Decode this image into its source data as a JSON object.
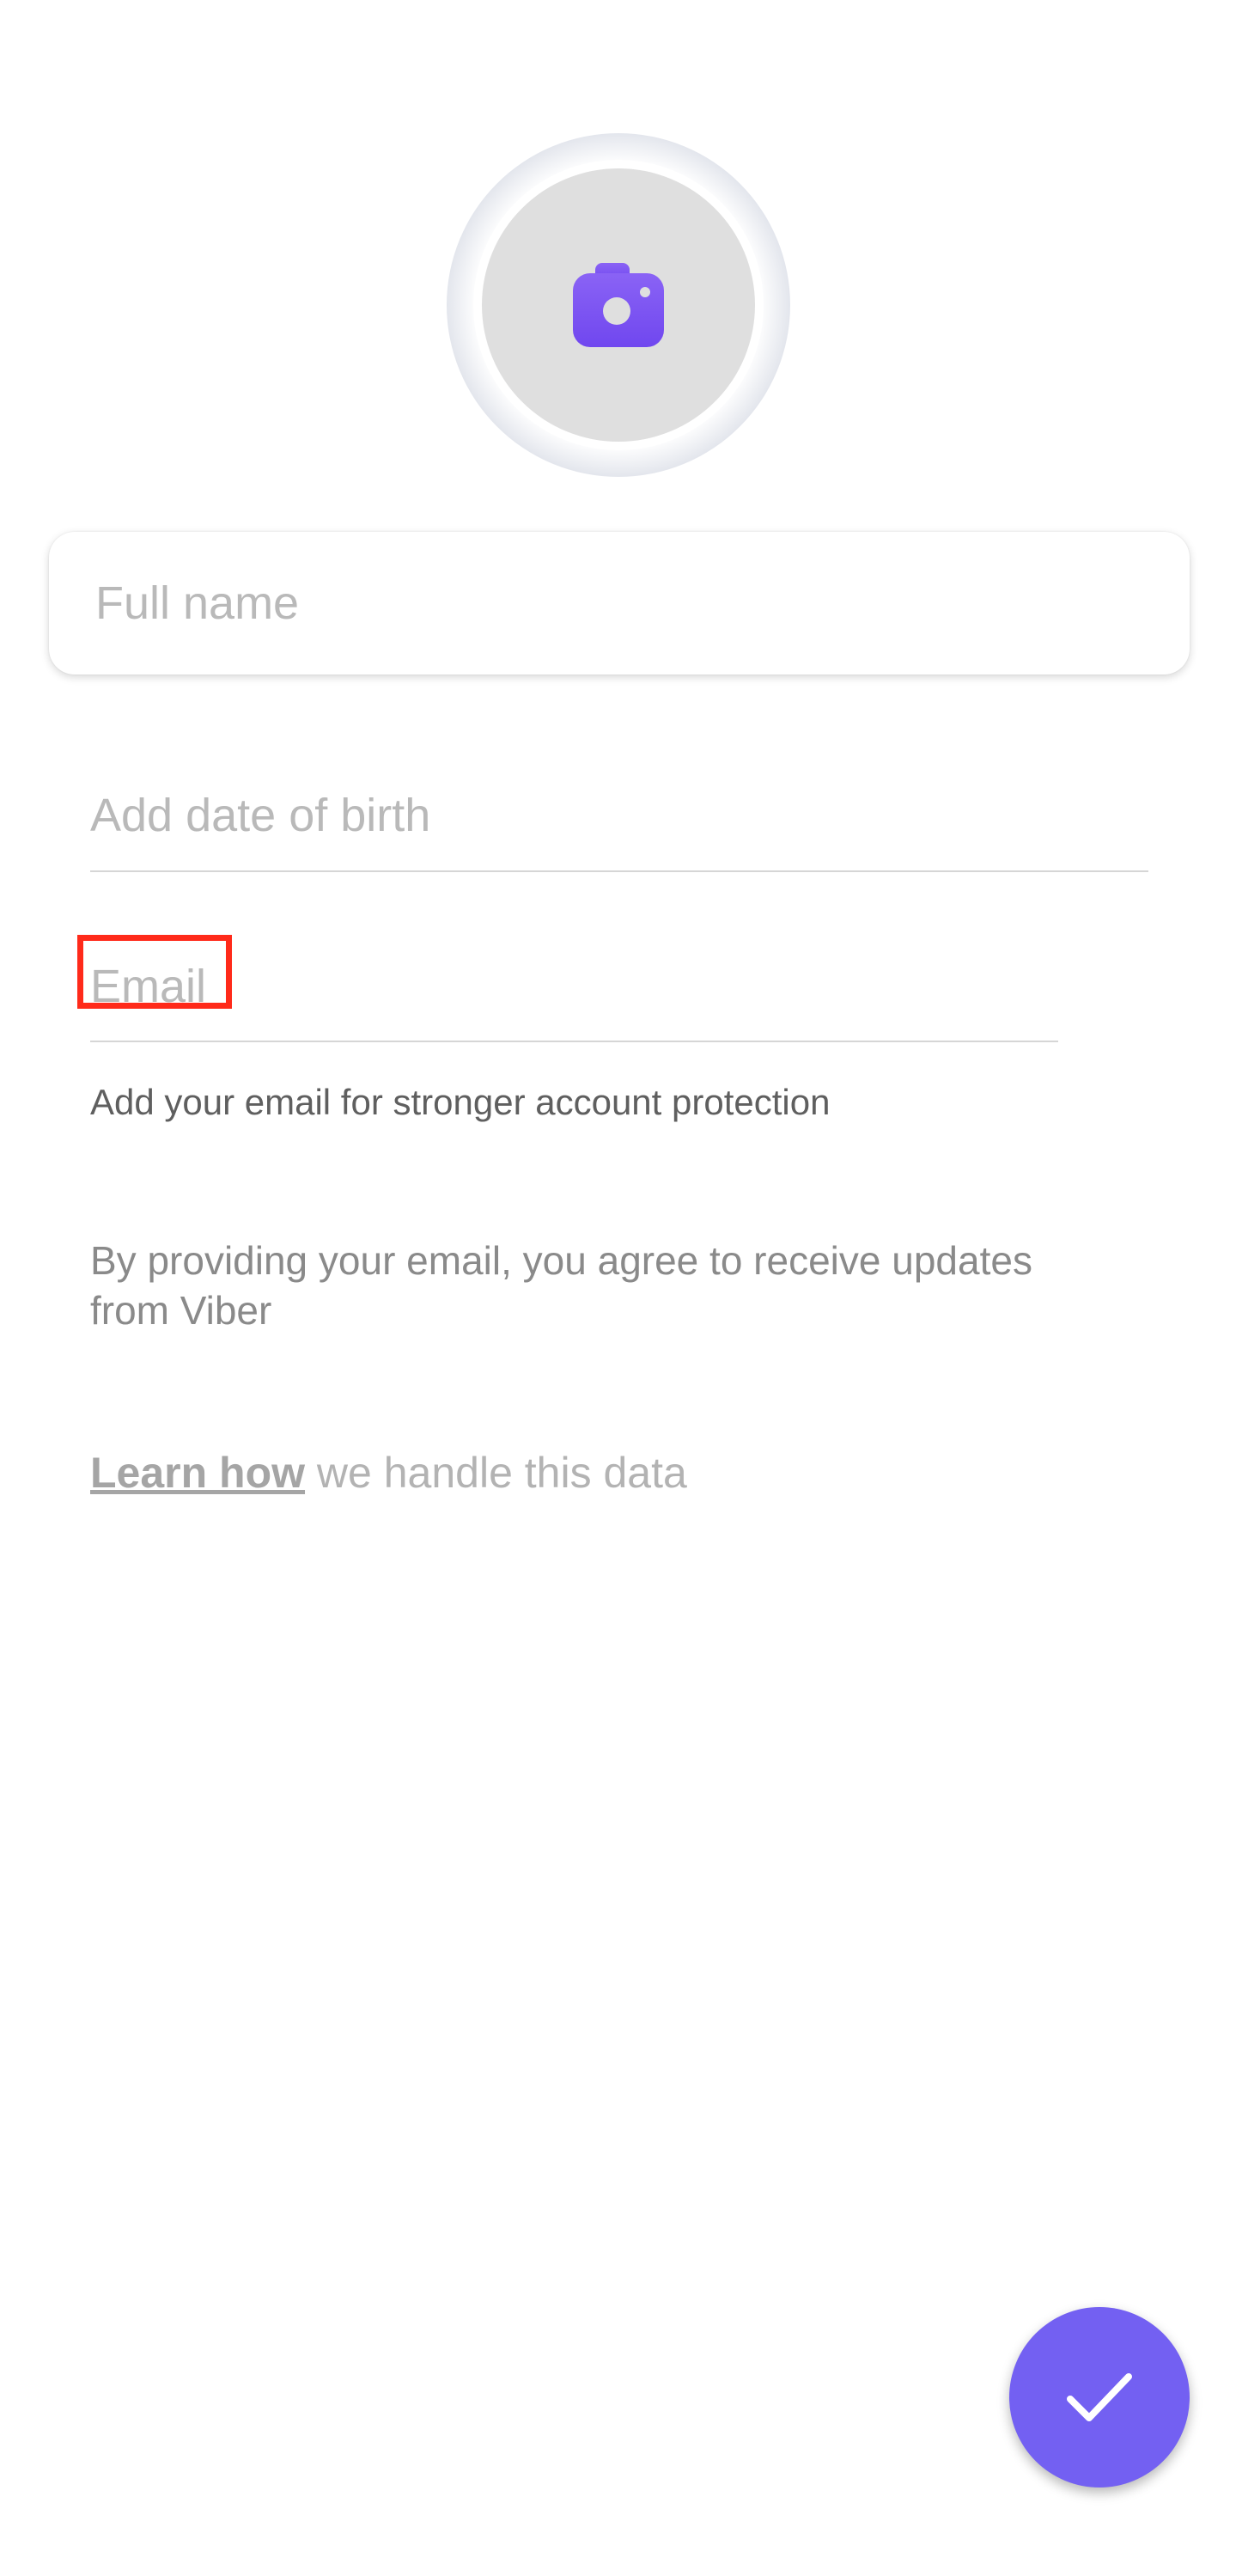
{
  "profile": {
    "avatar_icon": "camera-icon",
    "full_name_placeholder": "Full name",
    "dob_placeholder": "Add date of birth",
    "email_placeholder": "Email",
    "email_helper": "Add your email for stronger account protection",
    "consent_text": "By providing your email, you agree to receive updates from Viber",
    "learn_link": "Learn how",
    "learn_rest": " we handle this data",
    "submit_icon": "check-icon"
  },
  "colors": {
    "accent": "#7360f2",
    "highlight": "#ff2a1a",
    "avatar_bg": "#dfdfdf"
  }
}
